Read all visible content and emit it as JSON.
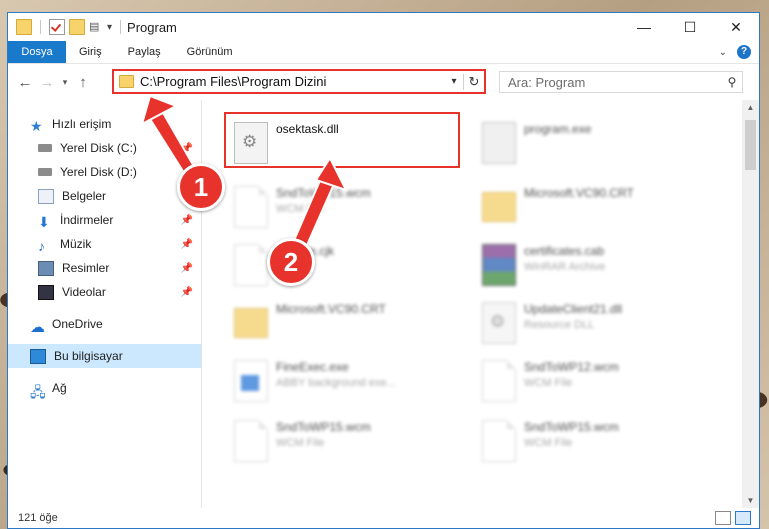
{
  "titlebar": {
    "title": "Program",
    "controls": [
      "—",
      "☐",
      "✕"
    ]
  },
  "ribbon": {
    "tabs": [
      "Dosya",
      "Giriş",
      "Paylaş",
      "Görünüm"
    ],
    "help": "?"
  },
  "navbar": {
    "address": "C:\\Program Files\\Program Dizini",
    "search_placeholder": "Ara: Program"
  },
  "sidebar": {
    "items": [
      {
        "label": "Hızlı erişim",
        "icon": "star-icon"
      },
      {
        "label": "Yerel Disk (C:)",
        "icon": "disk-icon"
      },
      {
        "label": "Yerel Disk (D:)",
        "icon": "disk-icon"
      },
      {
        "label": "Belgeler",
        "icon": "documents-icon"
      },
      {
        "label": "İndirmeler",
        "icon": "download-icon"
      },
      {
        "label": "Müzik",
        "icon": "music-icon"
      },
      {
        "label": "Resimler",
        "icon": "pictures-icon"
      },
      {
        "label": "Videolar",
        "icon": "videos-icon"
      },
      {
        "label": "OneDrive",
        "icon": "cloud-icon"
      },
      {
        "label": "Bu bilgisayar",
        "icon": "computer-icon"
      },
      {
        "label": "Ağ",
        "icon": "network-icon"
      }
    ]
  },
  "files": [
    {
      "name": "osektask.dll",
      "type": ""
    },
    {
      "name": "program.exe",
      "type": ""
    },
    {
      "name": "SndToWP15.wcm",
      "type": "WCM File"
    },
    {
      "name": "Microsoft.VC90.CRT",
      "type": ""
    },
    {
      "name": "Extcom.cjk",
      "type": ""
    },
    {
      "name": "certificates.cab",
      "type": "WinRAR Archive"
    },
    {
      "name": "Microsoft.VC90.CRT",
      "type": ""
    },
    {
      "name": "UpdateClient21.dll",
      "type": "Resource DLL"
    },
    {
      "name": "FineExec.exe",
      "type": "ABBY background exe..."
    },
    {
      "name": "SndToWP12.wcm",
      "type": "WCM File"
    },
    {
      "name": "SndToWP15.wcm",
      "type": "WCM File"
    },
    {
      "name": "SndToWP15.wcm",
      "type": "WCM File"
    }
  ],
  "status": {
    "count": "121 öğe"
  },
  "annotations": {
    "marker1": "1",
    "marker2": "2",
    "color": "#e8332c"
  }
}
